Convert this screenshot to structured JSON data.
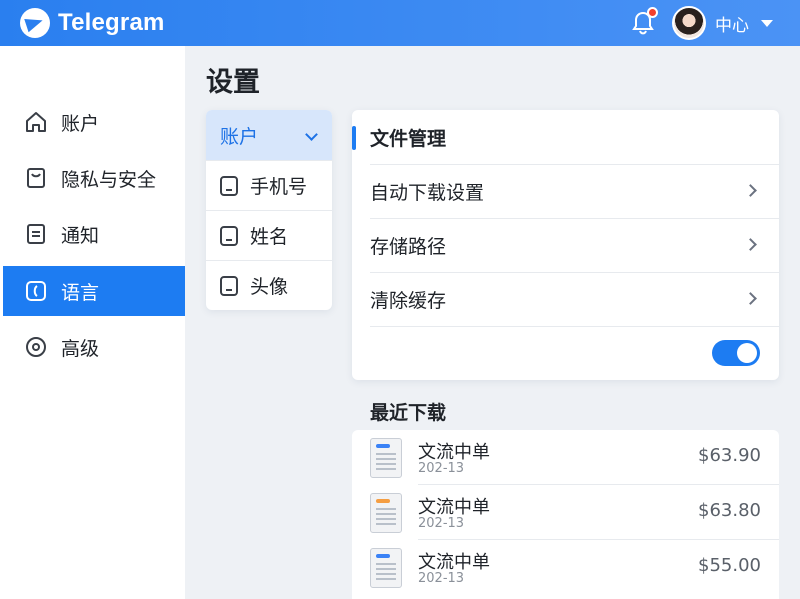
{
  "app": {
    "brand": "Telegram"
  },
  "header": {
    "user_name": "中心",
    "notification_dot_color": "#f2402f"
  },
  "sidebar": {
    "items": [
      {
        "label": "账户",
        "icon": "home-icon",
        "active": false
      },
      {
        "label": "隐私与安全",
        "icon": "shield-icon",
        "active": false
      },
      {
        "label": "通知",
        "icon": "document-icon",
        "active": false
      },
      {
        "label": "语言",
        "icon": "language-icon",
        "active": true
      },
      {
        "label": "高级",
        "icon": "target-icon",
        "active": false
      }
    ]
  },
  "page": {
    "title": "设置"
  },
  "submenu": {
    "header": "账户",
    "items": [
      {
        "label": "手机号",
        "icon": "phone-icon"
      },
      {
        "label": "姓名",
        "icon": "name-icon"
      },
      {
        "label": "头像",
        "icon": "avatar-icon"
      }
    ]
  },
  "file_panel": {
    "title": "文件管理",
    "rows": [
      {
        "label": "自动下载设置"
      },
      {
        "label": "存储路径"
      },
      {
        "label": "清除缓存"
      }
    ],
    "toggle_on": true
  },
  "recent": {
    "title": "最近下载",
    "items": [
      {
        "name": "文流中单",
        "date": "202-13",
        "price": "$63.90",
        "tag_color": "#3b82f6"
      },
      {
        "name": "文流中单",
        "date": "202-13",
        "price": "$63.80",
        "tag_color": "#f59e42"
      },
      {
        "name": "文流中单",
        "date": "202-13",
        "price": "$55.00",
        "tag_color": "#3b82f6"
      }
    ]
  },
  "colors": {
    "accent": "#1d7cf2",
    "header_bg": "#2a7fef"
  }
}
